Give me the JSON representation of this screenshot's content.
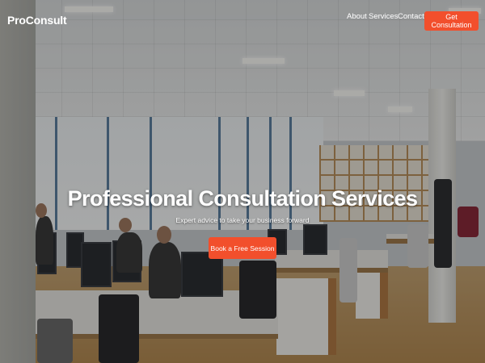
{
  "brand": {
    "name": "ProConsult"
  },
  "nav": {
    "links": [
      {
        "label": "About"
      },
      {
        "label": "Services"
      },
      {
        "label": "Contact"
      }
    ],
    "cta_label": "Get Consultation"
  },
  "hero": {
    "title": "Professional Consultation Services",
    "subtitle": "Expert advice to take your business forward",
    "cta_label": "Book a Free Session",
    "background": "office-photo"
  },
  "colors": {
    "accent": "#f24f2c",
    "text": "#ffffff"
  }
}
